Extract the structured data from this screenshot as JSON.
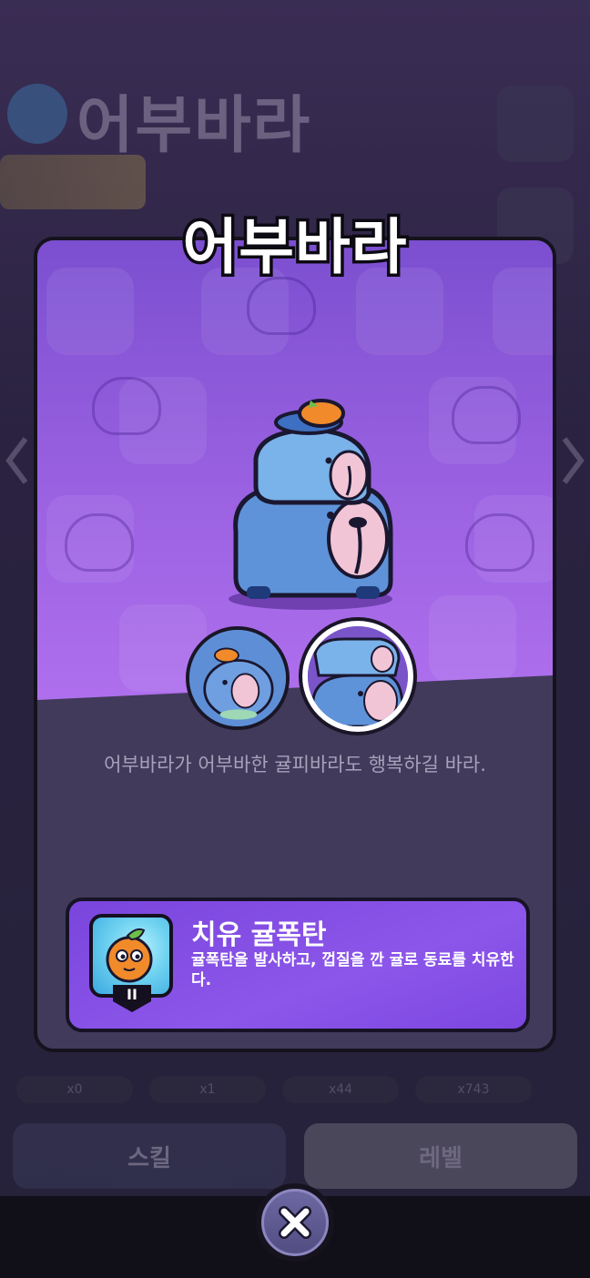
{
  "background": {
    "header_title": "어부바라",
    "tabs": [
      "x0",
      "x1",
      "x44",
      "x743"
    ],
    "left_button_label": "스킬",
    "right_button_label": "레벨"
  },
  "modal": {
    "title": "어부바라",
    "description": "어부바라가 어부바한 귤피바라도 행복하길 바라.",
    "skins": [
      {
        "name": "skin-1",
        "selected": false
      },
      {
        "name": "skin-2",
        "selected": true
      }
    ],
    "skill": {
      "name": "치유 귤폭탄",
      "description": "귤폭탄을 발사하고, 껍질을 깐 귤로 동료를 치유한다.",
      "level": "II",
      "icon": "orange-bomb-icon"
    }
  },
  "close_button": {
    "icon": "close-icon"
  },
  "colors": {
    "modal_bg": "#413a5b",
    "art_purple": "#9b62e2",
    "skill_card": "#8c56ea",
    "capybara_blue": "#5f93d9"
  }
}
